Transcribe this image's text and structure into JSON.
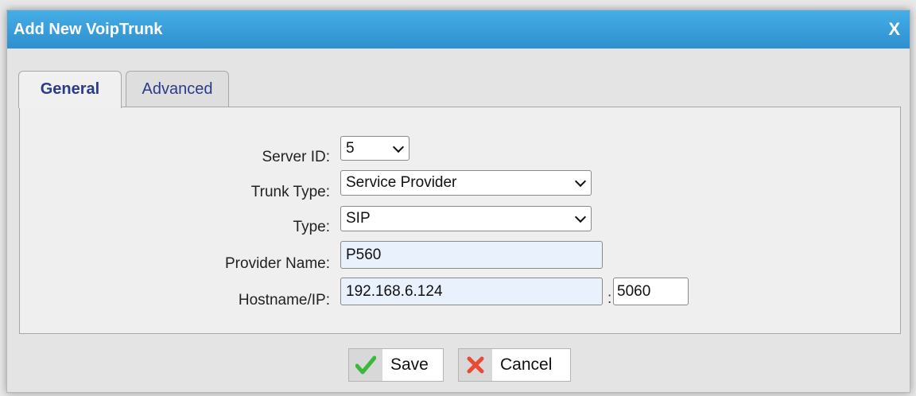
{
  "dialog": {
    "title": "Add New VoipTrunk",
    "close_label": "X"
  },
  "tabs": [
    {
      "label": "General",
      "active": true
    },
    {
      "label": "Advanced",
      "active": false
    }
  ],
  "form": {
    "server_id": {
      "label": "Server ID:",
      "value": "5"
    },
    "trunk_type": {
      "label": "Trunk Type:",
      "value": "Service Provider"
    },
    "type": {
      "label": "Type:",
      "value": "SIP"
    },
    "provider_name": {
      "label": "Provider Name:",
      "value": "P560"
    },
    "hostname": {
      "label": "Hostname/IP:",
      "value": "192.168.6.124",
      "separator": ":",
      "port": "5060"
    }
  },
  "buttons": {
    "save": "Save",
    "cancel": "Cancel"
  },
  "colors": {
    "titlebar": "#3aa0dd",
    "tab_text": "#2a3b8a",
    "input_bg": "#e9f1fc"
  }
}
